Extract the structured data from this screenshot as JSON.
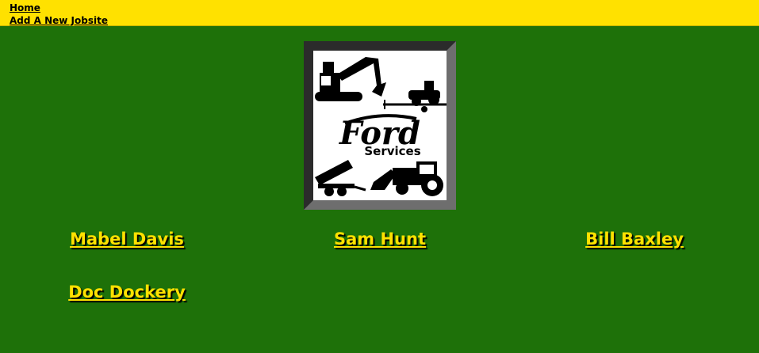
{
  "nav": {
    "home_label": "Home",
    "add_jobsite_label": "Add A New Jobsite"
  },
  "logo": {
    "brand": "Ford",
    "tagline": "Services"
  },
  "people": [
    {
      "name": "Mabel Davis"
    },
    {
      "name": "Sam Hunt"
    },
    {
      "name": "Bill Baxley"
    },
    {
      "name": "Doc Dockery"
    }
  ],
  "colors": {
    "background": "#1e7109",
    "topbar": "#ffe100",
    "link_text": "#ffe100"
  }
}
